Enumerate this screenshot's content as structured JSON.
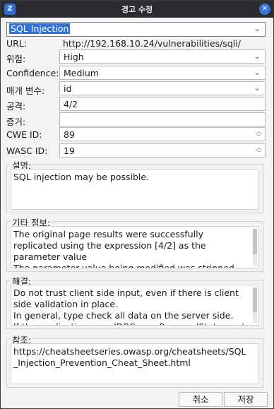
{
  "window": {
    "title": "경고 수정"
  },
  "alert_select": {
    "value": "SQL Injection"
  },
  "url": {
    "label": "URL:",
    "value": "http://192.168.10.24/vulnerabilities/sqli/"
  },
  "risk": {
    "label": "위험:",
    "value": "High"
  },
  "confidence": {
    "label": "Confidence:",
    "value": "Medium"
  },
  "param": {
    "label": "매개 변수:",
    "value": "id"
  },
  "attack": {
    "label": "공격:",
    "value": "4/2"
  },
  "evidence": {
    "label": "증거:",
    "value": ""
  },
  "cwe": {
    "label": "CWE ID:",
    "value": "89"
  },
  "wasc": {
    "label": "WASC ID:",
    "value": "19"
  },
  "description": {
    "label": "설명:",
    "text": "SQL injection may be possible."
  },
  "other_info": {
    "label": "기타 정보:",
    "text": "The original page results were successfully replicated using the expression [4/2] as the parameter value\nThe parameter value being modified was stripped from the HTML output for the purposes of the comparison"
  },
  "solution": {
    "label": "해결:",
    "text": "Do not trust client side input, even if there is client side validation in place.\nIn general, type check all data on the server side.\nIf the application uses JDBC, use PreparedStatement or"
  },
  "reference": {
    "label": "참조:",
    "text": "https://cheatsheetseries.owasp.org/cheatsheets/SQL_Injection_Prevention_Cheat_Sheet.html"
  },
  "buttons": {
    "cancel": "취소",
    "save": "저장"
  }
}
